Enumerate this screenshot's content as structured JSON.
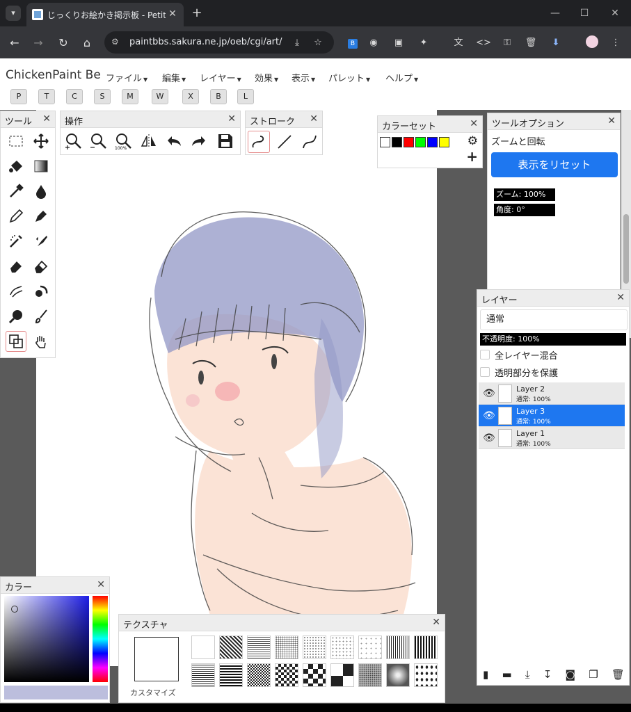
{
  "browser": {
    "tab_title": "じっくりお絵かき掲示板 - Petit Note",
    "url": "paintbbs.sakura.ne.jp/oeb/cgi/art/"
  },
  "app": {
    "brand": "ChickenPaint Be",
    "menus": [
      "ファイル",
      "編集",
      "レイヤー",
      "効果",
      "表示",
      "パレット",
      "ヘルプ"
    ],
    "shortcut_buttons": [
      "P",
      "T",
      "C",
      "S",
      "M",
      "W",
      "X",
      "B",
      "L"
    ]
  },
  "panels": {
    "tools": {
      "title": "ツール"
    },
    "operations": {
      "title": "操作"
    },
    "stroke": {
      "title": "ストローク"
    },
    "colorset": {
      "title": "カラーセット",
      "swatches": [
        "#ffffff",
        "#000000",
        "#ff0000",
        "#00ff00",
        "#0000ff",
        "#ffff00"
      ]
    },
    "tool_options": {
      "title": "ツールオプション",
      "label": "ズームと回転",
      "reset_button": "表示をリセット",
      "zoom": "ズーム: 100%",
      "angle": "角度: 0°"
    },
    "layers": {
      "title": "レイヤー",
      "blend_mode": "通常",
      "opacity": "不透明度: 100%",
      "sample_all": "全レイヤー混合",
      "lock_alpha": "透明部分を保護",
      "items": [
        {
          "name": "Layer 2",
          "mode": "通常: 100%"
        },
        {
          "name": "Layer 3",
          "mode": "通常: 100%"
        },
        {
          "name": "Layer 1",
          "mode": "通常: 100%"
        }
      ]
    },
    "color": {
      "title": "カラー"
    },
    "texture": {
      "title": "テクスチャ",
      "customize": "カスタマイズ"
    }
  },
  "colors": {
    "accent": "#1e77f0",
    "skin": "#fbe3d6",
    "hair": "#9297c6",
    "blush": "#f6b7b7"
  }
}
